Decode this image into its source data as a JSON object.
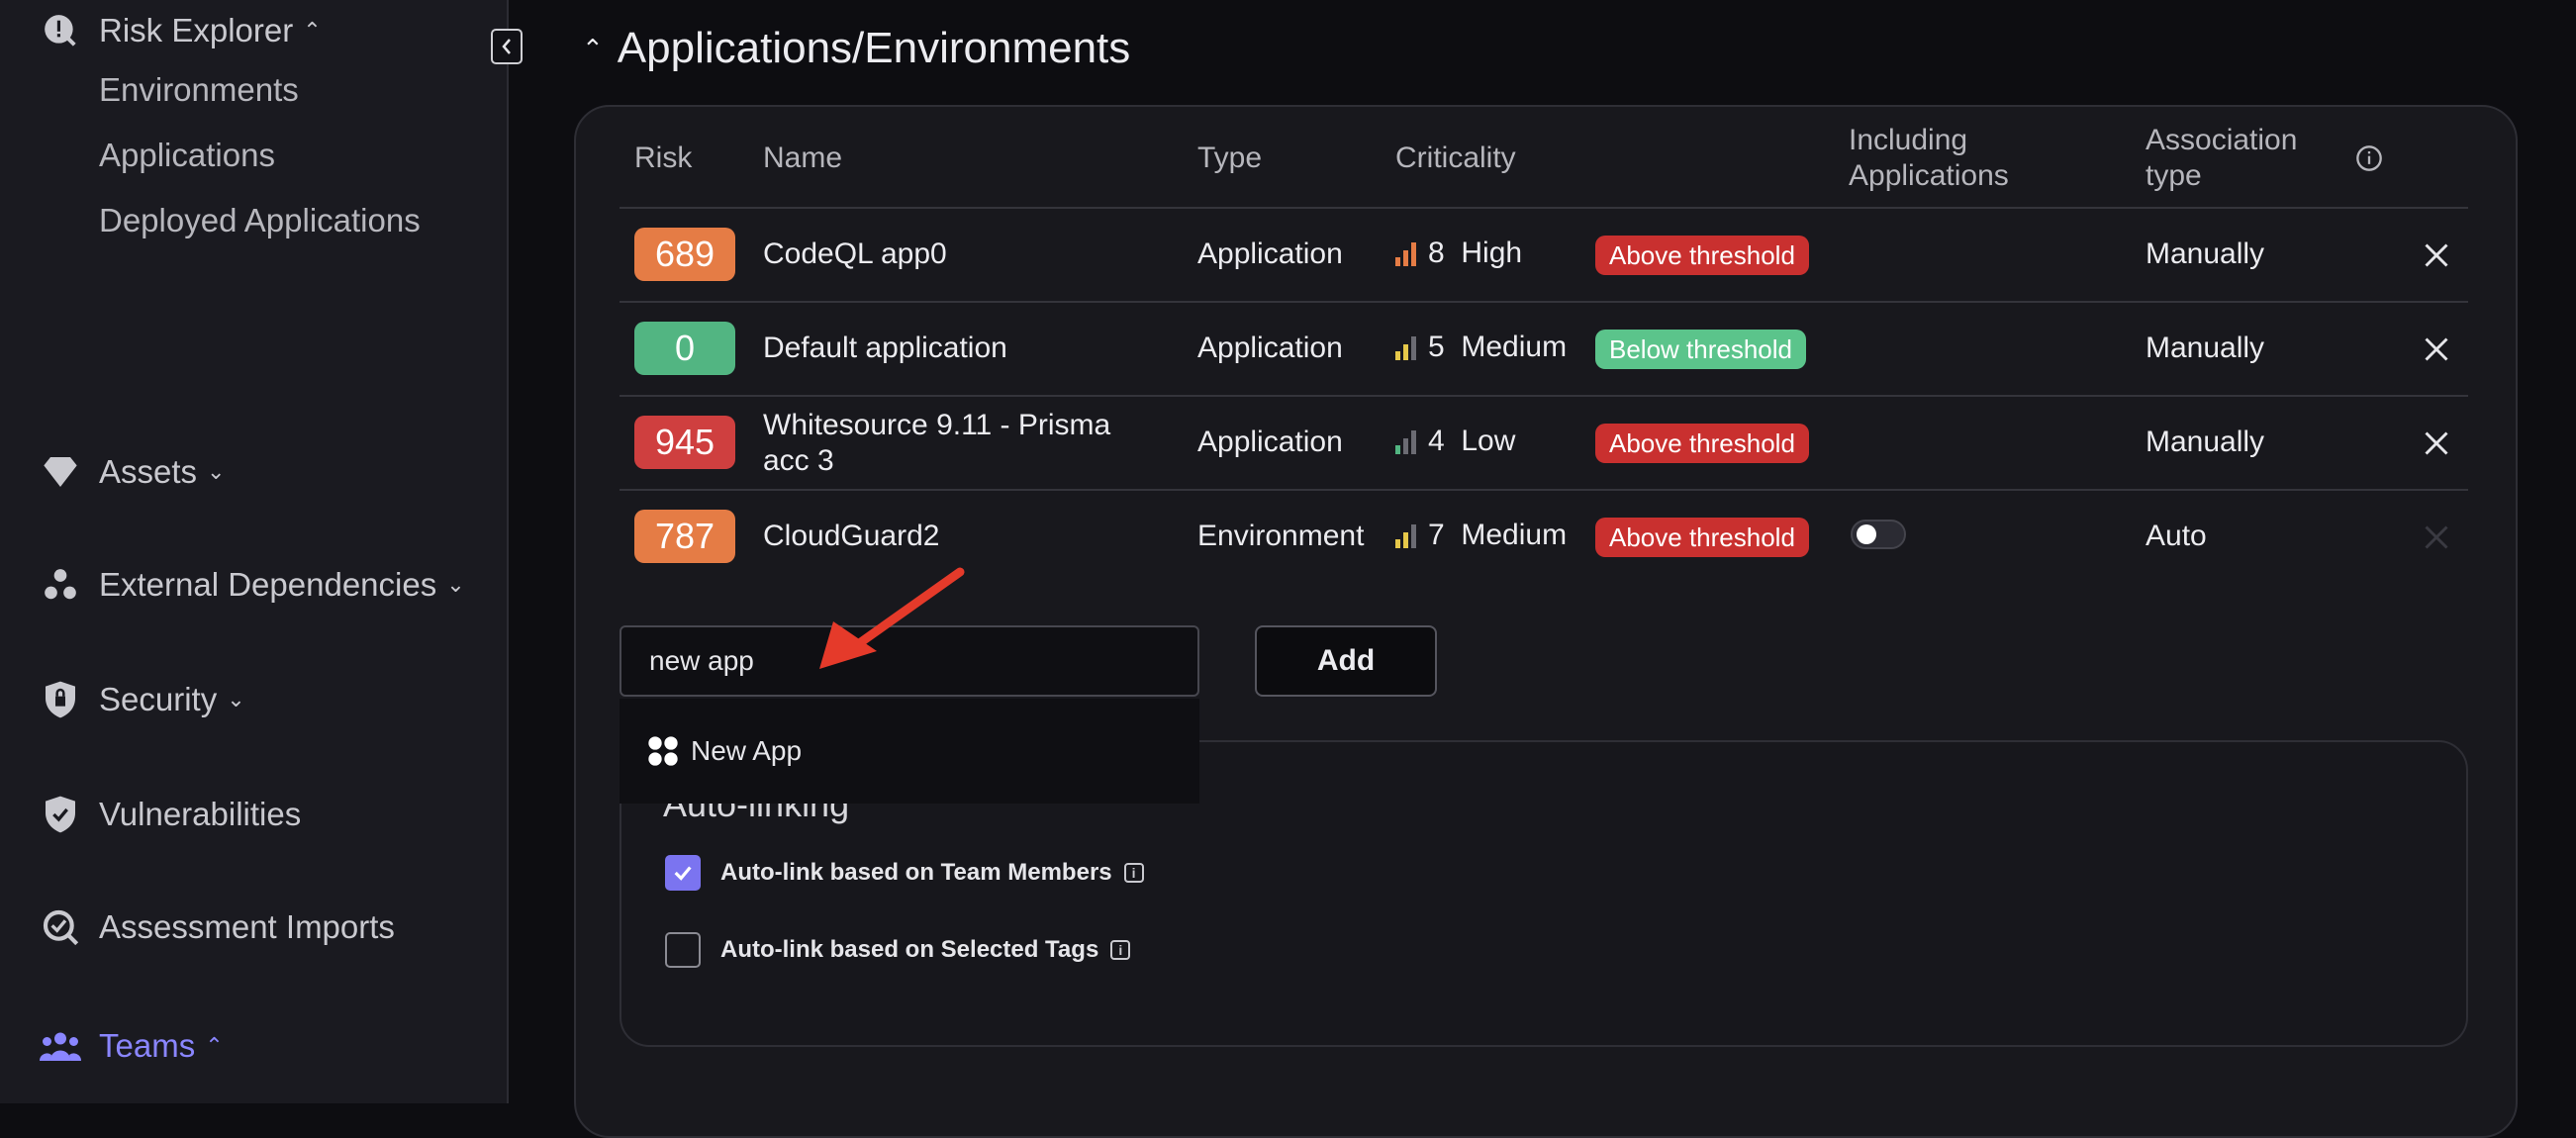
{
  "sidebar": {
    "risk_explorer": "Risk Explorer",
    "environments": "Environments",
    "applications": "Applications",
    "deployed_applications": "Deployed Applications",
    "assets": "Assets",
    "external_dependencies": "External Dependencies",
    "security": "Security",
    "vulnerabilities": "Vulnerabilities",
    "assessment_imports": "Assessment Imports",
    "teams": "Teams"
  },
  "section": {
    "title": "Applications/Environments"
  },
  "table": {
    "headers": {
      "risk": "Risk",
      "name": "Name",
      "type": "Type",
      "criticality": "Criticality",
      "including_line1": "Including",
      "including_line2": "Applications",
      "association_line1": "Association",
      "association_line2": "type"
    },
    "rows": [
      {
        "risk": "689",
        "name": "CodeQL app0",
        "name2": "",
        "type": "Application",
        "crit_num": "8",
        "crit_label": "High",
        "threshold": "Above threshold",
        "association": "Manually"
      },
      {
        "risk": "0",
        "name": "Default application",
        "name2": "",
        "type": "Application",
        "crit_num": "5",
        "crit_label": "Medium",
        "threshold": "Below threshold",
        "association": "Manually"
      },
      {
        "risk": "945",
        "name": "Whitesource 9.11 - Prisma",
        "name2": "acc 3",
        "type": "Application",
        "crit_num": "4",
        "crit_label": "Low",
        "threshold": "Above threshold",
        "association": "Manually"
      },
      {
        "risk": "787",
        "name": "CloudGuard2",
        "name2": "",
        "type": "Environment",
        "crit_num": "7",
        "crit_label": "Medium",
        "threshold": "Above threshold",
        "association": "Auto"
      }
    ]
  },
  "add_form": {
    "input_value": "new app",
    "add_label": "Add"
  },
  "dropdown": {
    "option_label": "New App"
  },
  "autolink": {
    "title": "Auto-linking",
    "team_members": "Auto-link based on Team Members",
    "selected_tags": "Auto-link based on Selected Tags"
  },
  "colors": {
    "accent": "#7b74f0",
    "risk_orange": "#e57c45",
    "risk_green": "#52b582",
    "risk_red": "#cf3f3f",
    "threshold_above": "#c9302f",
    "threshold_below": "#5bc48b"
  }
}
